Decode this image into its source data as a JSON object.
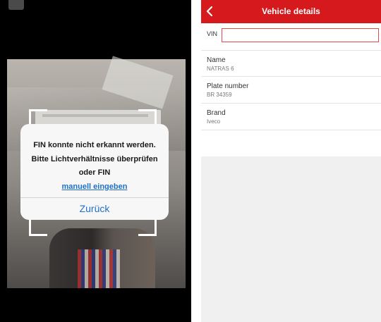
{
  "scanner": {
    "dialog": {
      "message_line1": "FIN konnte nicht erkannt werden.",
      "message_line2": "Bitte Lichtverhältnisse überprüfen",
      "message_line3": "oder FIN",
      "manual_link": "manuell eingeben",
      "back_button": "Zurück"
    },
    "icons": {
      "top_button": "camera-control-icon"
    }
  },
  "vehicle_details": {
    "header": {
      "title": "Vehicle details",
      "back_icon": "chevron-left-icon",
      "color": "#d5191d"
    },
    "vin": {
      "label": "VIN",
      "value": "",
      "placeholder": ""
    },
    "fields": [
      {
        "label": "Name",
        "value": "NATRAS 6"
      },
      {
        "label": "Plate number",
        "value": "BR 34359"
      },
      {
        "label": "Brand",
        "value": "Iveco"
      }
    ]
  },
  "colors": {
    "accent_red": "#d5191d",
    "link_blue": "#1f6fc4"
  }
}
